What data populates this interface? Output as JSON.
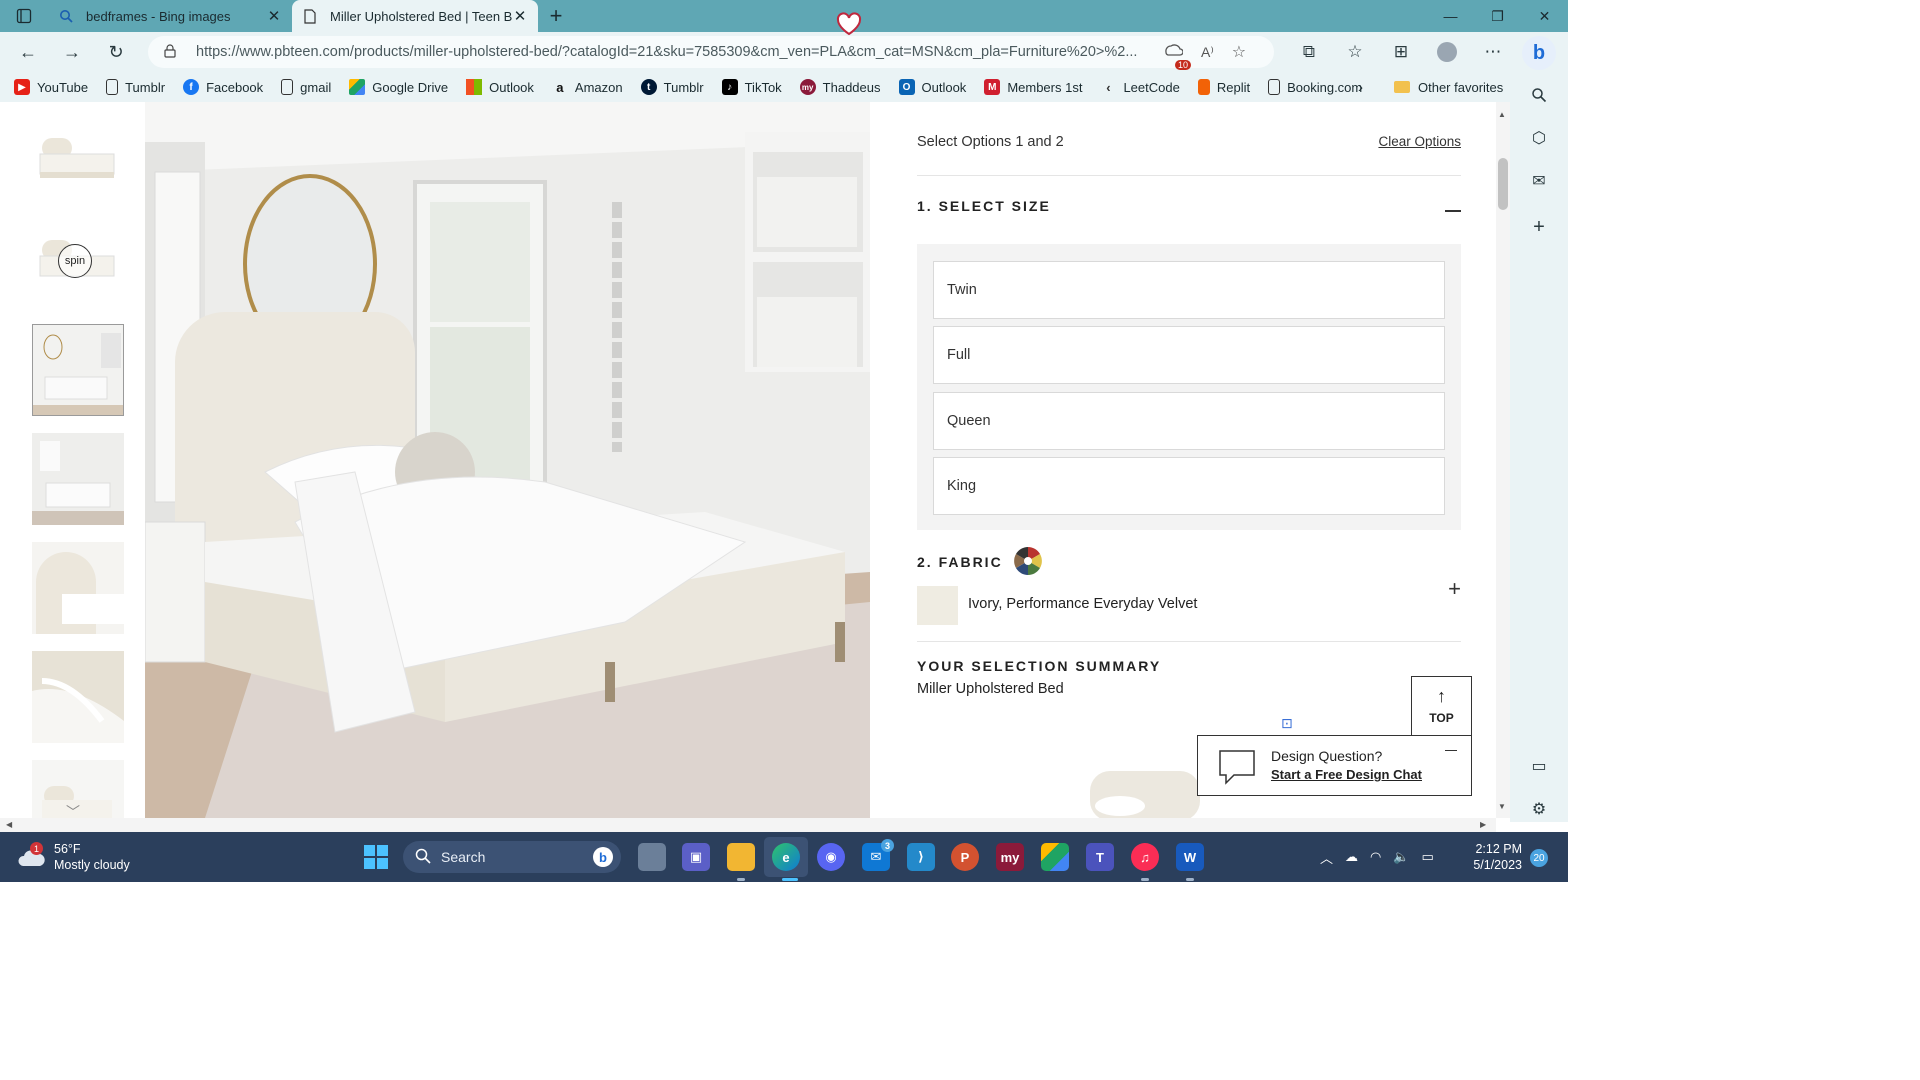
{
  "browser": {
    "tabs": [
      {
        "title": "bedframes - Bing images",
        "icon": "search-icon"
      },
      {
        "title": "Miller Upholstered Bed | Teen Be",
        "icon": "page-icon"
      }
    ],
    "url": "https://www.pbteen.com/products/miller-upholstered-bed/?catalogId=21&sku=7585309&cm_ven=PLA&cm_cat=MSN&cm_pla=Furniture%20>%2...",
    "tracker_badge": "10",
    "favorites": [
      {
        "label": "YouTube",
        "color": "#e62117"
      },
      {
        "label": "Tumblr",
        "color": "#ffffff"
      },
      {
        "label": "Facebook",
        "color": "#1877f2"
      },
      {
        "label": "gmail",
        "color": "#ffffff"
      },
      {
        "label": "Google Drive",
        "color": "#1fa463"
      },
      {
        "label": "Outlook",
        "color": "#f25022"
      },
      {
        "label": "Amazon",
        "color": "#ffffff"
      },
      {
        "label": "Tumblr",
        "color": "#001935"
      },
      {
        "label": "TikTok",
        "color": "#000000"
      },
      {
        "label": "Thaddeus",
        "color": "#8b1a3a"
      },
      {
        "label": "Outlook",
        "color": "#0a64b4"
      },
      {
        "label": "Members 1st",
        "color": "#d01f2f"
      },
      {
        "label": "LeetCode",
        "color": "#ffffff"
      },
      {
        "label": "Replit",
        "color": "#f26207"
      },
      {
        "label": "Booking.com",
        "color": "#ffffff"
      }
    ],
    "other_favorites": "Other favorites"
  },
  "product": {
    "spin_label": "spin",
    "select_header": "Select Options 1 and 2",
    "clear_options": "Clear Options",
    "section1_title": "1. SELECT SIZE",
    "sizes": [
      "Twin",
      "Full",
      "Queen",
      "King"
    ],
    "section2_title": "2. FABRIC",
    "fabric_selected": "Ivory, Performance Everyday Velvet",
    "summary_title": "YOUR SELECTION SUMMARY",
    "summary_item": "Miller Upholstered Bed",
    "top_label": "TOP",
    "chat_title": "Design Question?",
    "chat_link": "Start a Free Design Chat"
  },
  "taskbar": {
    "weather_temp": "56°F",
    "weather_desc": "Mostly cloudy",
    "weather_badge": "1",
    "search_label": "Search",
    "mail_badge": "3",
    "time": "2:12 PM",
    "date": "5/1/2023",
    "notifications": "20"
  }
}
